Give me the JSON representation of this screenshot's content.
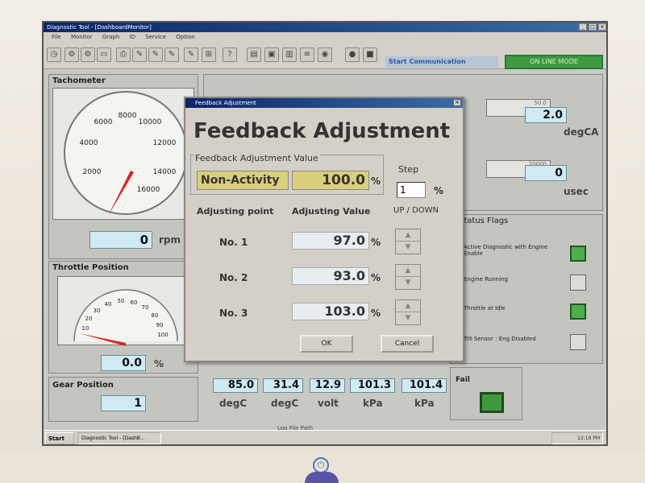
{
  "window": {
    "title": "Diagnostic Tool - [DashboardMonitor]"
  },
  "menu": [
    "File",
    "Monitor",
    "Graph",
    "ID",
    "Service",
    "Option"
  ],
  "toolbar": {
    "start_communication": "Start Communication",
    "online_mode": "ON LINE MODE"
  },
  "tachometer": {
    "title": "Tachometer",
    "scale": [
      "2000",
      "4000",
      "6000",
      "8000",
      "10000",
      "12000",
      "14000",
      "16000"
    ],
    "value": "0",
    "unit": "rpm"
  },
  "throttle": {
    "title": "Throttle Position",
    "scale": [
      "10",
      "20",
      "30",
      "40",
      "50",
      "60",
      "70",
      "80",
      "90",
      "100"
    ],
    "value": "0.0",
    "unit": "%"
  },
  "gear": {
    "title": "Gear Position",
    "value": "1"
  },
  "right_top": {
    "input_a_max": "50.0",
    "input_b_max": "20000",
    "value_a": "2.0",
    "unit_a": "degCA",
    "value_b": "0",
    "unit_b": "usec"
  },
  "status_flags": {
    "title": "Status Flags",
    "items": [
      {
        "label": "Active Diagnostic with Engine Enable",
        "on": true
      },
      {
        "label": "Engine Running",
        "on": false
      },
      {
        "label": "Throttle at Idle",
        "on": true
      },
      {
        "label": "Tilt Sensor : Eng Disabled",
        "on": false
      }
    ]
  },
  "fail": {
    "label": "Fail"
  },
  "bottom_readings": [
    {
      "value": "85.0",
      "unit": "degC"
    },
    {
      "value": "31.4",
      "unit": "degC"
    },
    {
      "value": "12.9",
      "unit": "volt"
    },
    {
      "value": "101.3",
      "unit": "kPa"
    },
    {
      "value": "101.4",
      "unit": "kPa"
    }
  ],
  "log_file_path": "Log File Path",
  "dialog": {
    "window_title": "Feedback Adjustment",
    "heading": "Feedback Adjustment",
    "group_label": "Feedback Adjustment Value",
    "mode": "Non-Activity",
    "value": "100.0",
    "percent": "%",
    "step_label": "Step",
    "step_value": "1",
    "col_point": "Adjusting point",
    "col_value": "Adjusting Value",
    "col_updown": "UP / DOWN",
    "rows": [
      {
        "point": "No. 1",
        "value": "97.0"
      },
      {
        "point": "No. 2",
        "value": "93.0"
      },
      {
        "point": "No. 3",
        "value": "103.0"
      }
    ],
    "ok": "OK",
    "cancel": "Cancel"
  },
  "taskbar": {
    "start": "Start",
    "task": "Diagnostic Tool - [DashB...",
    "clock": "12:18 PM"
  }
}
